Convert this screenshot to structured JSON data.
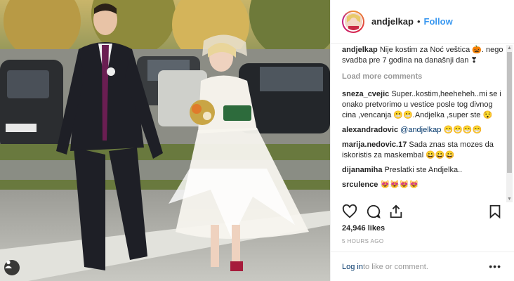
{
  "post": {
    "username": "andjelkap",
    "follow_label": "Follow",
    "separator": "•",
    "caption_user": "andjelkap",
    "caption_text": "Nije kostim za Noć veštica 🎃. nego svadba pre 7 godina na današnji dan ❣",
    "load_more": "Load more comments",
    "comments": [
      {
        "user": "sneza_cvejic",
        "text": "Super..kostim,heeheheh..mi se i onako pretvorimo u vestice posle tog divnog cina ,vencanja 😬😬.Andjelka ,super ste 😯"
      },
      {
        "user": "alexandradovic",
        "text": "@andjelkap 😁😁😁😁"
      },
      {
        "user": "marija.nedovic.17",
        "text": "Sada znas sta mozes da iskoristis za maskembal 😀😀😀"
      },
      {
        "user": "dijanamiha",
        "text": "Preslatki ste Andjelka.."
      },
      {
        "user": "srculence",
        "text": "😻😻😻😻"
      }
    ],
    "likes": "24,946 likes",
    "time": "5 HOURS AGO",
    "login_link": "Log in",
    "login_rest": " to like or comment.",
    "more_label": "•••"
  },
  "icons": {
    "heart": "heart-icon",
    "comment": "comment-icon",
    "share": "share-icon",
    "bookmark": "bookmark-icon",
    "tag": "person-tag-icon"
  },
  "colors": {
    "follow": "#3897f0",
    "link": "#003569",
    "muted": "#999999"
  }
}
